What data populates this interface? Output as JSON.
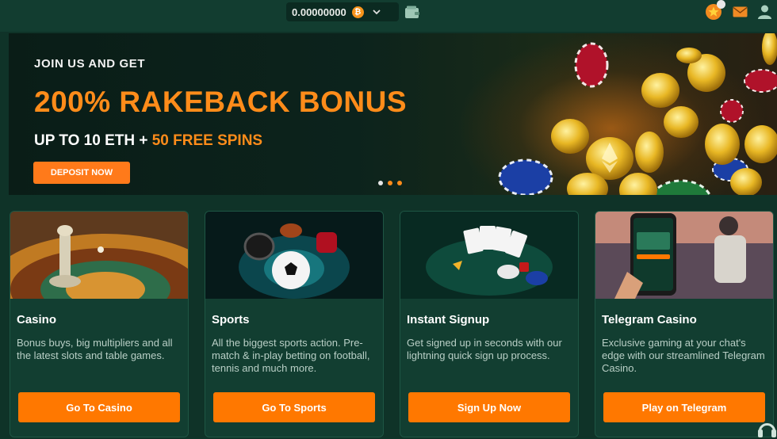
{
  "header": {
    "balance": "0.00000000",
    "currency_icon": "bitcoin-icon",
    "currency_symbol": "₿"
  },
  "hero": {
    "eyebrow": "JOIN US AND GET",
    "title": "200% RAKEBACK BONUS",
    "subtitle_prefix": "UP TO 10 ETH + ",
    "subtitle_accent": "50 FREE SPINS",
    "cta": "DEPOSIT NOW",
    "slide_count": 3,
    "active_slide": 1
  },
  "cards": [
    {
      "title": "Casino",
      "description": "Bonus buys, big multipliers and all the latest slots and table games.",
      "button": "Go To Casino"
    },
    {
      "title": "Sports",
      "description": "All the biggest sports action. Pre-match & in-play betting on football, tennis and much more.",
      "button": "Go To Sports"
    },
    {
      "title": "Instant Signup",
      "description": "Get signed up in seconds with our lightning quick sign up process.",
      "button": "Sign Up Now"
    },
    {
      "title": "Telegram Casino",
      "description": "Exclusive gaming at your chat's edge with our streamlined Telegram Casino.",
      "button": "Play on Telegram"
    }
  ],
  "colors": {
    "background": "#0f3328",
    "accent": "#ff7800",
    "card": "#123e31"
  }
}
